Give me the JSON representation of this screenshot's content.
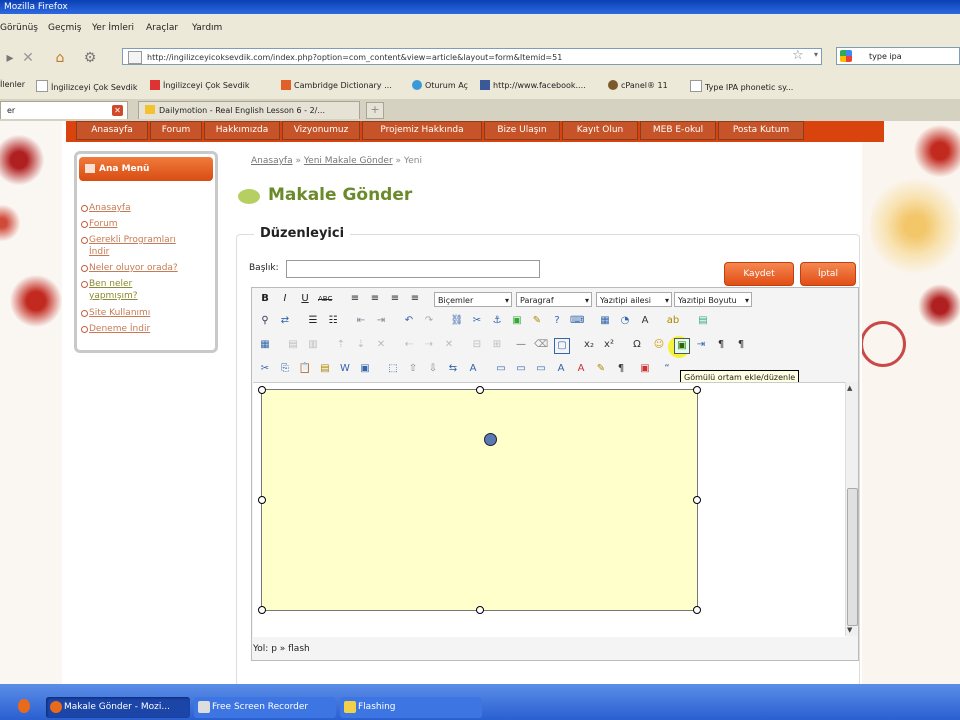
{
  "window": {
    "title": "Mozilla Firefox"
  },
  "menu": {
    "items": [
      "Görünüş",
      "Geçmiş",
      "Yer İmleri",
      "Araçlar",
      "Yardım"
    ]
  },
  "nav": {
    "url": "http://ingilizceyicoksevdik.com/index.php?option=com_content&view=article&layout=form&Itemid=51",
    "search_value": "type ipa"
  },
  "bookmarks": [
    "İlenler",
    "İngilizceyi Çok Sevdik",
    "İngilizceyi Çok Sevdik",
    "Cambridge Dictionary ...",
    "Oturum Aç",
    "http://www.facebook....",
    "cPanel® 11",
    "Type IPA phonetic sy..."
  ],
  "tabs": [
    {
      "label": "er"
    },
    {
      "label": "Dailymotion - Real English Lesson 6 - 2/..."
    }
  ],
  "site_nav": [
    "Anasayfa",
    "Forum",
    "Hakkımızda",
    "Vizyonumuz",
    "Projemiz Hakkında",
    "Bize Ulaşın",
    "Kayıt Olun",
    "MEB E-okul",
    "Posta Kutum"
  ],
  "sidebar": {
    "title": "Ana Menü",
    "items": [
      "Anasayfa",
      "Forum",
      "Gerekli Programları İndir",
      "Neler oluyor orada?",
      "Ben neler yapmışım?",
      "Site Kullanımı",
      "Deneme İndir"
    ]
  },
  "breadcrumb": {
    "home": "Anasayfa",
    "section": "Yeni Makale Gönder",
    "current": "Yeni",
    "sep": "»"
  },
  "page_title": "Makale Gönder",
  "editor_section": "Düzenleyici",
  "form": {
    "title_label": "Başlık:",
    "title_value": "",
    "save_label": "Kaydet",
    "cancel_label": "İptal"
  },
  "editor": {
    "selects": [
      "Biçemler",
      "Paragraf",
      "Yazıtipi ailesi",
      "Yazıtipi Boyutu"
    ],
    "tooltip": "Gömülü ortam ekle/düzenle",
    "path": "Yol: p » flash"
  },
  "taskbar": [
    {
      "label": "Makale Gönder - Mozi..."
    },
    {
      "label": "Free Screen Recorder"
    },
    {
      "label": "Flashing"
    }
  ],
  "colors": {
    "accent": "#d9440e",
    "title_green": "#6b8a2a",
    "flash_bg": "#ffffcc",
    "highlight": "#f6f12a"
  }
}
